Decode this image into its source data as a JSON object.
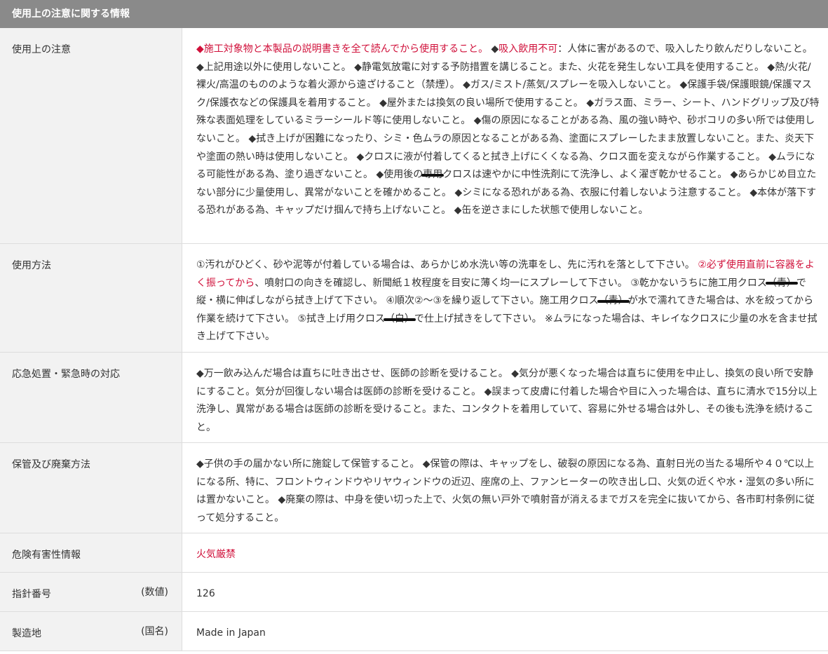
{
  "header": {
    "title": "使用上の注意に関する情報"
  },
  "rows": {
    "caution": {
      "label": "使用上の注意",
      "p1_red": "◆施工対象物と本製品の説明書きを全て読んでから使用すること。",
      "p2": " ◆",
      "p3_red": "吸入飲用不可",
      "p4": "：人体に害があるので、吸入したり飲んだりしないこと。 ◆上記用途以外に使用しないこと。 ◆静電気放電に対する予防措置を講じること。また、火花を発生しない工具を使用すること。 ◆熱/火花/裸火/高温のもののような着火源から遠ざけること（禁煙）。 ◆ガス/ミスト/蒸気/スプレーを吸入しないこと。 ◆保護手袋/保護眼鏡/保護マスク/保護衣などの保護具を着用すること。 ◆屋外または換気の良い場所で使用すること。 ◆ガラス面、ミラー、シート、ハンドグリップ及び特殊な表面処理をしているミラーシールド等に使用しないこと。 ◆傷の原因になることがある為、風の強い時や、砂ボコリの多い所では使用しないこと。 ◆拭き上げが困難になったり、シミ・色ムラの原因となることがある為、塗面にスプレーしたまま放置しないこと。また、炎天下や塗面の熱い時は使用しないこと。 ◆クロスに液が付着してくると拭き上げにくくなる為、クロス面を変えながら作業すること。 ◆ムラになる可能性がある為、塗り過ぎないこと。 ◆使用後の",
      "p5_strike": "専用",
      "p6": "クロスは速やかに中性洗剤にて洗浄し、よく濯ぎ乾かせること。 ◆あらかじめ目立たない部分に少量使用し、異常がないことを確かめること。 ◆シミになる恐れがある為、衣服に付着しないよう注意すること。 ◆本体が落下する恐れがある為、キャップだけ掴んで持ち上げないこと。 ◆缶を逆さまにした状態で使用しないこと。"
    },
    "usage": {
      "label": "使用方法",
      "p1": "①汚れがひどく、砂や泥等が付着している場合は、あらかじめ水洗い等の洗車をし、先に汚れを落として下さい。 ",
      "p2_red": "②必ず使用直前に容器をよく振ってから",
      "p3": "、噴射口の向きを確認し、新聞紙１枚程度を目安に薄く均一にスプレーして下さい。 ③乾かないうちに施工用クロス",
      "p4_strike": "（青）",
      "p5": "で縦・横に伸ばしながら拭き上げて下さい。 ④順次②～③を繰り返して下さい。施工用クロス",
      "p6_strike": "（青）",
      "p7": "が水で濡れてきた場合は、水を絞ってから作業を続けて下さい。 ⑤拭き上げ用クロス",
      "p8_strike": "（白）",
      "p9": "で仕上げ拭きをして下さい。 ※ムラになった場合は、キレイなクロスに少量の水を含ませ拭き上げて下さい。"
    },
    "emergency": {
      "label": "応急処置・緊急時の対応",
      "text": "◆万一飲み込んだ場合は直ちに吐き出させ、医師の診断を受けること。 ◆気分が悪くなった場合は直ちに使用を中止し、換気の良い所で安静にすること。気分が回復しない場合は医師の診断を受けること。 ◆誤まって皮膚に付着した場合や目に入った場合は、直ちに清水で15分以上洗浄し、異常がある場合は医師の診断を受けること。また、コンタクトを着用していて、容易に外せる場合は外し、その後も洗浄を続けること。"
    },
    "storage": {
      "label": "保管及び廃棄方法",
      "text": "◆子供の手の届かない所に施錠して保管すること。 ◆保管の際は、キャップをし、破裂の原因になる為、直射日光の当たる場所や４０℃以上になる所、特に、フロントウィンドウやリヤウィンドウの近辺、座席の上、ファンヒーターの吹き出し口、火気の近くや水・湿気の多い所には置かないこと。 ◆廃棄の際は、中身を使い切った上で、火気の無い戸外で噴射音が消えるまでガスを完全に抜いてから、各市町村条例に従って処分すること。"
    },
    "hazard": {
      "label": "危険有害性情報",
      "value": "火気厳禁"
    },
    "guide": {
      "label": "指針番号",
      "unit": "(数値)",
      "value": "126"
    },
    "origin": {
      "label": "製造地",
      "unit": "(国名)",
      "value": "Made in Japan"
    }
  },
  "colors": {
    "header_bg": "#8a8a8a",
    "label_bg": "#f2f2f2",
    "accent_red": "#d0103a"
  }
}
